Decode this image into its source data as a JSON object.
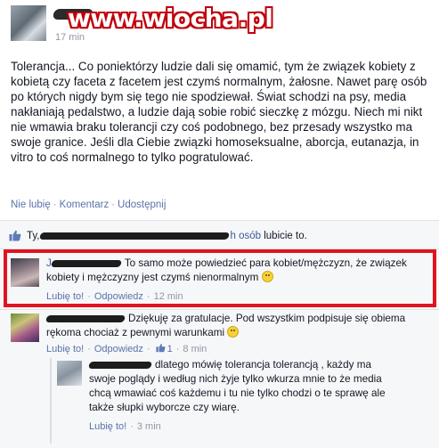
{
  "watermark": "www.wiocha.pl",
  "post": {
    "timestamp": "17 min",
    "text": "Tolerancja... Co poniektórzy ludzie dali się omamić, tym że związek kobiety z kobietą czy faceta z facetem jest czymś normalnym, żałosne. Nawet parę osób po których nigdy bym się tego nie spodziewał. Świat schodzi na psy, media nakłaniają pedalstwo, a ludzie dają sobie robić sieczkę z mózgu. Niech mi nikt nie wmawia braku tolerancji czy coś podobnego, bez przesady wszystko ma swoje granice. Jeśli dla Ciebie związki homoseksualne, aborcja, eutanazja, in vitro to coś normalnego to tylko pogratulować.",
    "actions": [
      "Nie lubię",
      "Komentarz",
      "Udostępnij"
    ]
  },
  "likes": {
    "prefix": "Ty,",
    "link": "h osób",
    "suffix": "lubicie to."
  },
  "comments": [
    {
      "name_prefix": "J",
      "text": "To samo może powiedzieć para kobiet/mężczyzn, że związek kobiety i mężczyzny jest czymś nienormalnym",
      "like_label": "Lubię to!",
      "reply_label": "Odpowiedz",
      "time": "12 min",
      "highlighted": true
    },
    {
      "name_prefix": "",
      "text": "Dziękuję za gratulacje. Pod wszystkim podpisuje się obiema rękoma chociaż z pewnymi warunkami",
      "like_label": "Lubię to!",
      "reply_label": "Odpowiedz",
      "like_count": "1",
      "time": "8 min"
    },
    {
      "name_prefix": "",
      "text": "dlatego mówię tolerancja tolerancją , każdy ma swoje poglądy i według nich żyje tylko wkurza mnie to że media chcą wmawiać coś każdemu i tu nie tylko chodzi o te sprawę ale także słupki wyborcze czy wiarę.",
      "like_label": "Lubię to!",
      "time": "3 min"
    }
  ],
  "colors": {
    "link": "#3b5998",
    "highlight_border": "#e0141e",
    "footer_bg": "#f6f7f9",
    "meta_text": "#9197a3"
  }
}
